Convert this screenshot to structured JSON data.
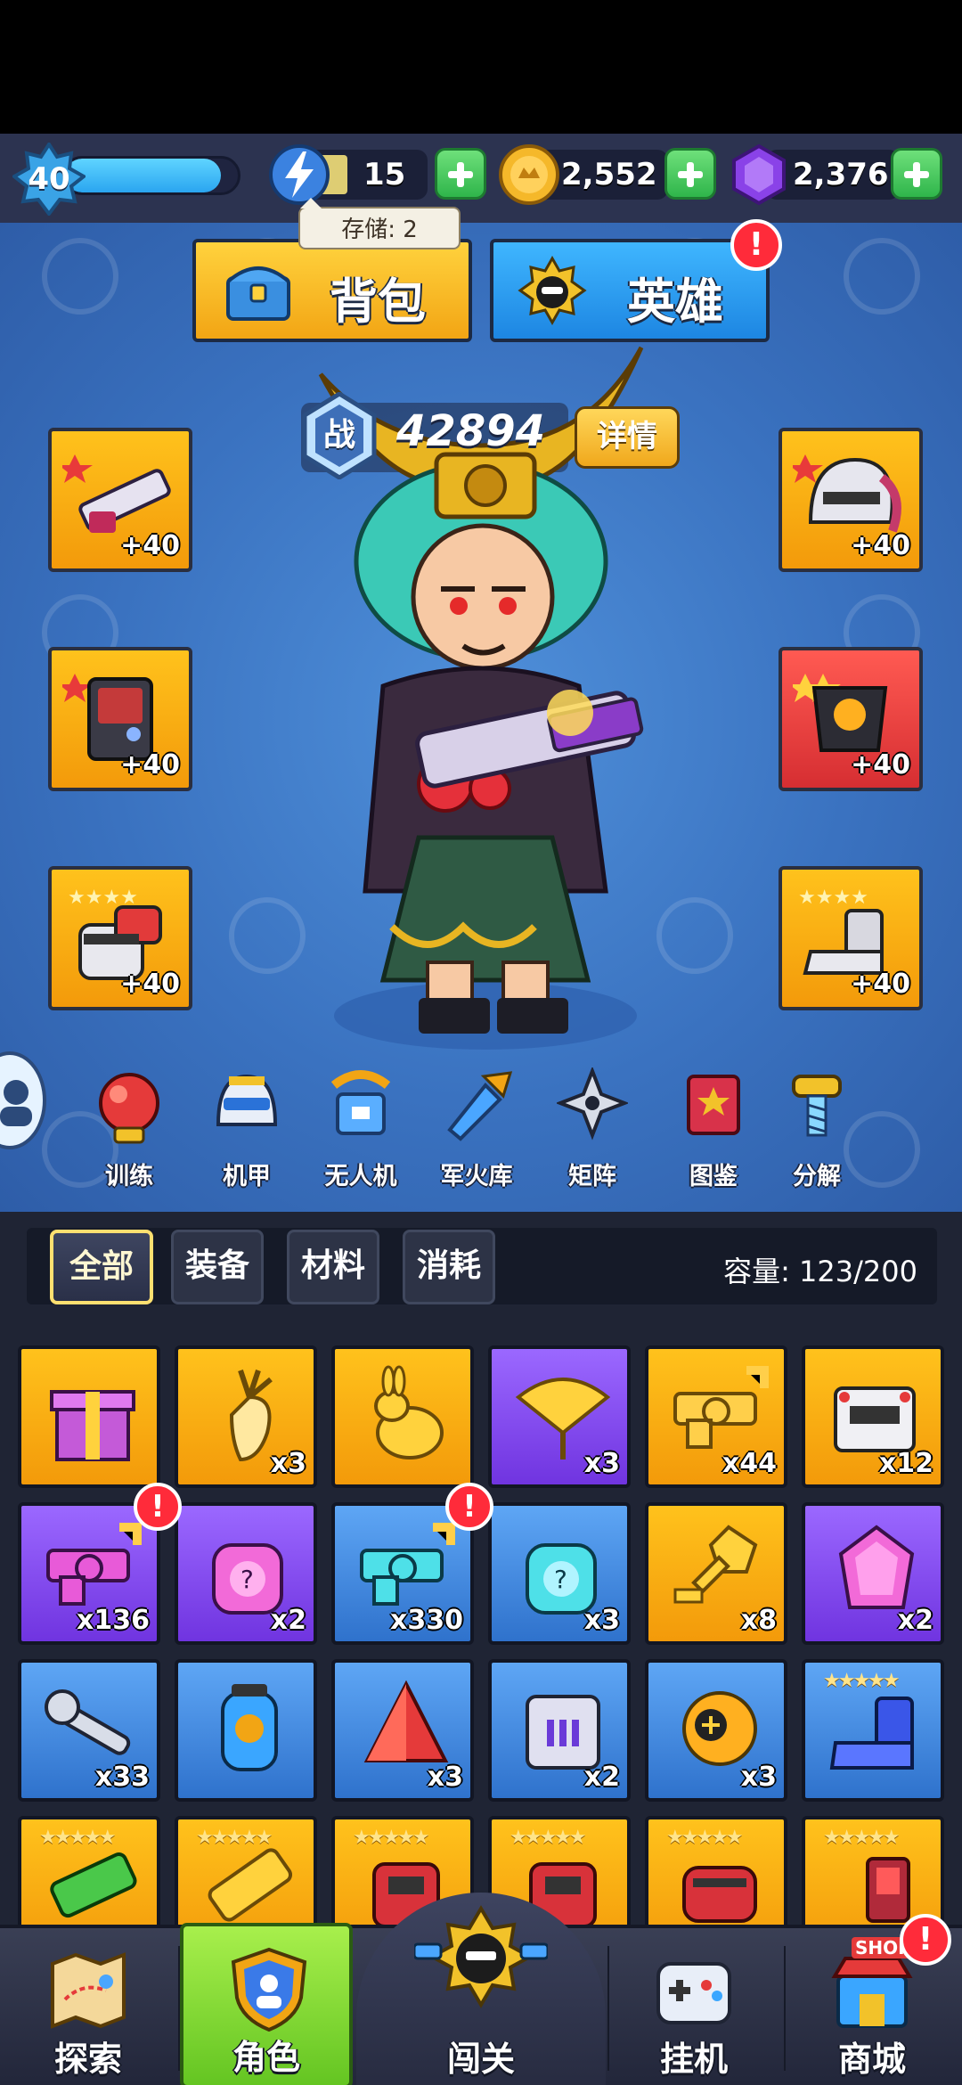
{
  "player": {
    "level": "40",
    "xp_fraction": 0.9
  },
  "resources": {
    "energy": {
      "value": "15",
      "icon": "lightning-icon"
    },
    "coins": {
      "value": "2,552",
      "icon": "coin-icon"
    },
    "gems": {
      "value": "2,376",
      "icon": "purple-gem-icon"
    }
  },
  "energy_tooltip": "存储: 2",
  "tabs": {
    "backpack": "背包",
    "hero": "英雄"
  },
  "alert_mark": "!",
  "power": {
    "label": "战",
    "value": "42894",
    "details_button": "详情"
  },
  "equipment_slots": {
    "left": [
      {
        "name": "weapon",
        "level": "+40",
        "stars": 1
      },
      {
        "name": "armor-chest",
        "level": "+40",
        "stars": 1
      },
      {
        "name": "gauntlet",
        "level": "+40",
        "stars": 4
      }
    ],
    "right": [
      {
        "name": "helmet",
        "level": "+40",
        "stars": 1
      },
      {
        "name": "chest-plate",
        "level": "+40",
        "stars": 2
      },
      {
        "name": "boots",
        "level": "+40",
        "stars": 4
      }
    ]
  },
  "feature_menu": [
    "训练",
    "机甲",
    "无人机",
    "军火库",
    "矩阵",
    "图鉴",
    "分解"
  ],
  "inventory": {
    "filters": [
      "全部",
      "装备",
      "材料",
      "消耗"
    ],
    "active_filter": "全部",
    "capacity": "容量: 123/200",
    "rows": [
      [
        {
          "icon": "gift-box-icon",
          "count": "",
          "color": "o"
        },
        {
          "icon": "radish-icon",
          "count": "x3",
          "color": "o"
        },
        {
          "icon": "golden-rabbit-icon",
          "count": "",
          "color": "o"
        },
        {
          "icon": "ginkgo-leaf-icon",
          "count": "x3",
          "color": "p"
        },
        {
          "icon": "weapon-blueprint-icon",
          "count": "x44",
          "color": "o"
        },
        {
          "icon": "armor-crate-icon",
          "count": "x12",
          "color": "o"
        }
      ],
      [
        {
          "icon": "weapon-blueprint-icon",
          "count": "x136",
          "color": "p"
        },
        {
          "icon": "mystery-chest-icon",
          "count": "x2",
          "color": "p"
        },
        {
          "icon": "weapon-blueprint-icon",
          "count": "x330",
          "color": "b"
        },
        {
          "icon": "mystery-chest-icon",
          "count": "x3",
          "color": "b"
        },
        {
          "icon": "gold-key-icon",
          "count": "x8",
          "color": "o"
        },
        {
          "icon": "pink-crystal-icon",
          "count": "x2",
          "color": "p"
        }
      ],
      [
        {
          "icon": "wrench-icon",
          "count": "x33",
          "color": "b"
        },
        {
          "icon": "gadget-icon",
          "count": "",
          "color": "b"
        },
        {
          "icon": "red-pyramid-icon",
          "count": "x3",
          "color": "b"
        },
        {
          "icon": "metal-cube-icon",
          "count": "x2",
          "color": "b"
        },
        {
          "icon": "orb-icon",
          "count": "x3",
          "color": "b"
        },
        {
          "icon": "blue-boot-icon",
          "count": "",
          "color": "b",
          "stars": "★★★★★"
        }
      ],
      [
        {
          "icon": "green-weapon-icon",
          "count": "",
          "color": "o",
          "stars": "★★★★★"
        },
        {
          "icon": "gold-weapon-icon",
          "count": "",
          "color": "o",
          "stars": "★★★★★"
        },
        {
          "icon": "red-armor-icon",
          "count": "",
          "color": "o",
          "stars": "★★★★★"
        },
        {
          "icon": "red-armor-icon",
          "count": "",
          "color": "o",
          "stars": "★★★★★"
        },
        {
          "icon": "red-gauntlet-icon",
          "count": "",
          "color": "o",
          "stars": "★★★★★"
        },
        {
          "icon": "red-boot-icon",
          "count": "",
          "color": "o",
          "stars": "★★★★★"
        }
      ]
    ]
  },
  "bottom_nav": [
    {
      "label": "探索",
      "icon": "map-icon"
    },
    {
      "label": "角色",
      "icon": "character-shield-icon",
      "active": true
    },
    {
      "label": "闯关",
      "icon": "battle-emblem-icon"
    },
    {
      "label": "挂机",
      "icon": "gamepad-icon"
    },
    {
      "label": "商城",
      "icon": "shop-icon",
      "badge": "SHOP"
    }
  ],
  "colors": {
    "slot_orange": "#f9b014",
    "rarity_purple": "#8a52f5",
    "rarity_blue": "#4a8fe2",
    "nav_active": "#86da36",
    "alert_red": "#ff2b3a"
  }
}
